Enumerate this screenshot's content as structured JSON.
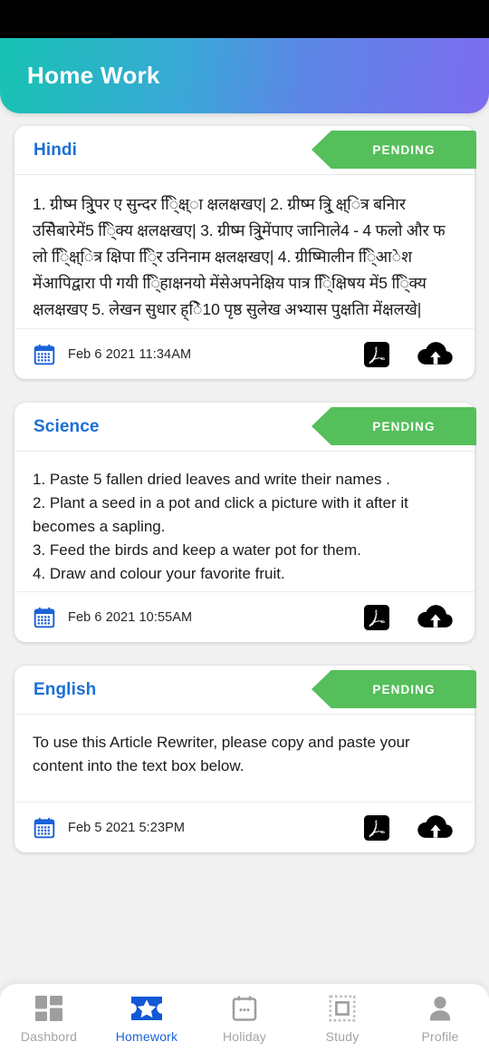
{
  "header": {
    "title": "Home Work"
  },
  "colors": {
    "gradient_start": "#17c3b2",
    "gradient_end": "#7d6cf0",
    "subject_blue": "#1b6fd6",
    "status_green": "#55bf5b",
    "active_nav_blue": "#1a62d8",
    "page_background": "#f1f1f1",
    "calendar_icon_blue": "#1a62d8"
  },
  "cards": [
    {
      "subject": "Hindi",
      "status": "PENDING",
      "description": "1. ग्रीष्म त्रि्ुपर ए सुन्दर ि्िक्ष्ा क्षलक्षखए| 2. ग्रीष्म त्रि्ु क्ष्ित्र बनिार उसिेबारेमें5 ि्िक्य क्षलक्षखए| 3. ग्रीष्म त्रि्ुमेंपाए जानिाले4 - 4 फलो और फ लो ि्िक्ष्ित्र क्षिपा ि्िर उनिनाम क्षलक्षखए| 4. ग्रीष्मिालीन ि्िआेश मेंआपिद्वारा पी गयी ि्िहाक्षनयो मेंसेअपनेक्षिय पात्र ि्िक्षिषय में5 ि्िक्य क्षलक्षखए 5. लेखन सुधार ह्ेि10 पृष्ठ सुलेख अभ्यास पुक्षतिा मेंक्षलखे|",
      "script": "devanagari",
      "date": "Feb  6 2021 11:34AM",
      "pdf_icon": "pdf-icon",
      "upload_icon": "cloud-upload-icon",
      "calendar_icon": "calendar-icon"
    },
    {
      "subject": "Science",
      "status": "PENDING",
      "description": "1. Paste 5 fallen dried leaves and write their names .\n2. Plant a seed in a pot and click a picture with it after it becomes a sapling.\n3. Feed the birds and keep a water pot for them.\n4. Draw and colour your favorite fruit.",
      "script": "latin",
      "date": "Feb  6 2021 10:55AM",
      "pdf_icon": "pdf-icon",
      "upload_icon": "cloud-upload-icon",
      "calendar_icon": "calendar-icon"
    },
    {
      "subject": "English",
      "status": "PENDING",
      "description": "To use this Article Rewriter, please copy and paste your content into the text box below.",
      "script": "latin",
      "date": "Feb  5 2021  5:23PM",
      "pdf_icon": "pdf-icon",
      "upload_icon": "cloud-upload-icon",
      "calendar_icon": "calendar-icon"
    }
  ],
  "bottom_nav": {
    "items": [
      {
        "label": "Dashbord",
        "icon": "dashboard-grid-icon",
        "active": false
      },
      {
        "label": "Homework",
        "icon": "ticket-star-icon",
        "active": true
      },
      {
        "label": "Holiday",
        "icon": "calendar-dots-icon",
        "active": false
      },
      {
        "label": "Study",
        "icon": "dashed-square-icon",
        "active": false
      },
      {
        "label": "Profile",
        "icon": "person-icon",
        "active": false
      }
    ]
  }
}
